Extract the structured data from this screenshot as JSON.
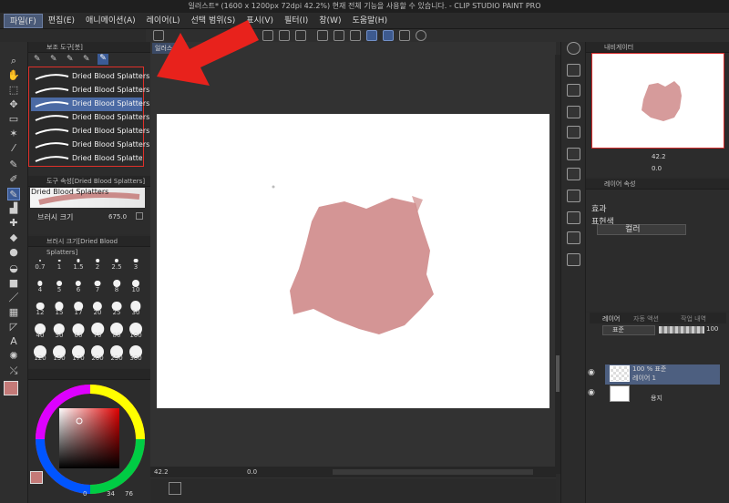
{
  "window": {
    "title": "일러스트* (1600 x 1200px 72dpi 42.2%)  현재 전체 기능을 사용할 수 있습니다. - CLIP STUDIO PAINT PRO"
  },
  "menu": [
    "파일(F)",
    "편집(E)",
    "애니메이션(A)",
    "레이어(L)",
    "선택 범위(S)",
    "표시(V)",
    "필터(I)",
    "창(W)",
    "도움말(H)"
  ],
  "canvas_tab": "일러스",
  "subtool": {
    "header": "보조 도구[붓]",
    "brushes": [
      "Dried Blood Splatters",
      "Dried Blood Splatters",
      "Dried Blood Splatters",
      "Dried Blood Splatters",
      "Dried Blood Splatters",
      "Dried Blood Splatters",
      "Dried Blood Splatters"
    ],
    "selected_index": 2
  },
  "tool_property": {
    "header": "도구 속성[Dried Blood Splatters]",
    "brush_name": "Dried Blood Splatters",
    "size_label": "브러시 크기",
    "size_value": "675.0"
  },
  "brush_size": {
    "header": "브러시 크기[Dried Blood Splatters]",
    "rows": [
      [
        "0.7",
        "1",
        "1.5",
        "2",
        "2.5",
        "3"
      ],
      [
        "4",
        "5",
        "6",
        "7",
        "8",
        "10"
      ],
      [
        "12",
        "15",
        "17",
        "20",
        "25",
        "30"
      ],
      [
        "40",
        "50",
        "60",
        "70",
        "80",
        "100"
      ],
      [
        "120",
        "150",
        "170",
        "200",
        "250",
        "300"
      ]
    ]
  },
  "color": {
    "main_color": "#c47a78",
    "sub_color": "#ffffff",
    "readout": [
      "0",
      "34",
      "76"
    ]
  },
  "status": {
    "zoom": "42.2",
    "rotation": "0.0"
  },
  "navigator": {
    "header": "내비게이터",
    "zoom": "42.2",
    "rotation": "0.0"
  },
  "layer_property": {
    "header": "레이어 속성",
    "effect_label": "효과",
    "expression_label": "표현색",
    "expression_value": "컬러"
  },
  "layers": {
    "tabs": [
      "레이어",
      "자동 액션",
      "작업 내역"
    ],
    "blend_mode": "표준",
    "opacity": "100",
    "items": [
      {
        "title": "100 % 표준",
        "name": "레이어 1"
      },
      {
        "title": "",
        "name": "용지"
      }
    ]
  },
  "colors": {
    "accent": "#4b6aa4",
    "highlight_red": "#e0302a",
    "splat": "#cf8a89"
  }
}
